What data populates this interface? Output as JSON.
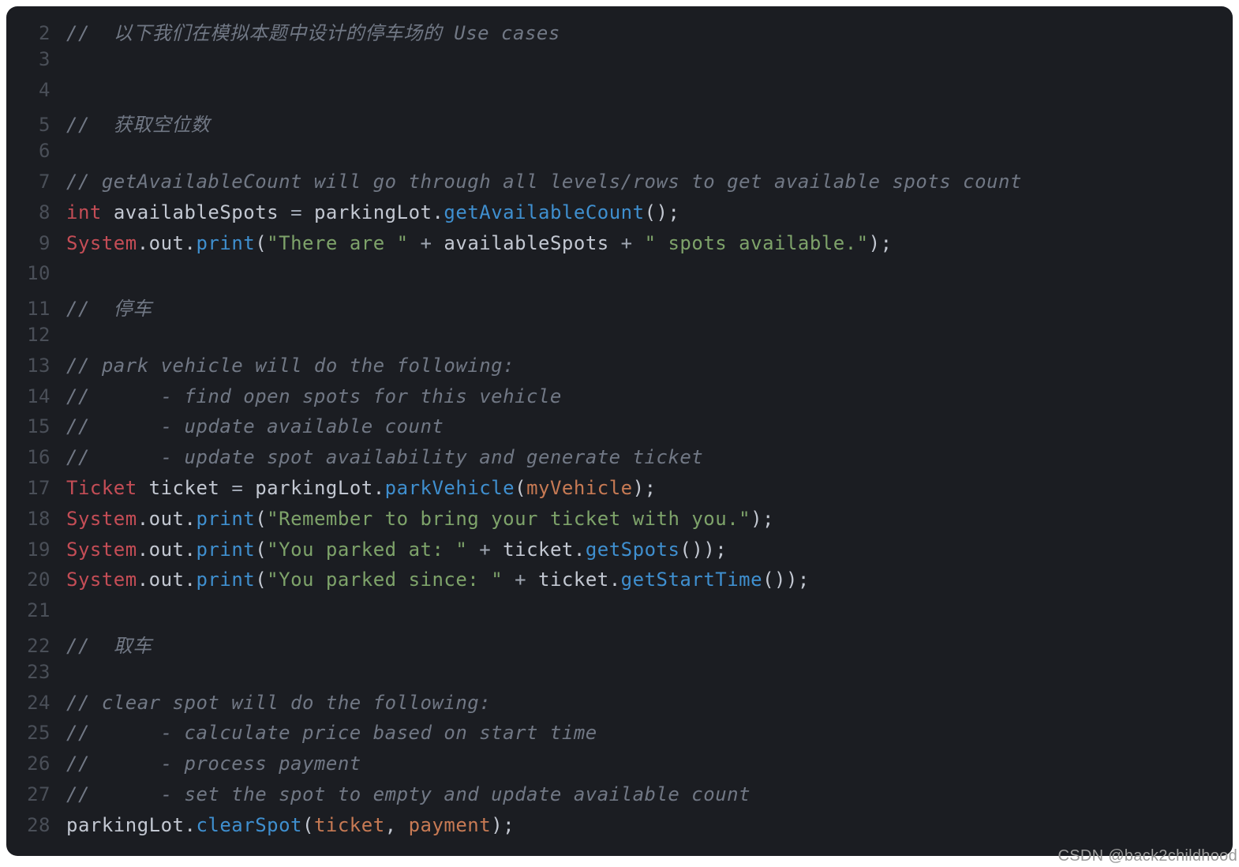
{
  "watermark": "CSDN @back2childhood",
  "lines": [
    {
      "num": "2",
      "tokens": [
        {
          "cls": "tok-comment",
          "text": "//  以下我们在模拟本题中设计的停车场的 Use cases"
        }
      ]
    },
    {
      "num": "3",
      "tokens": []
    },
    {
      "num": "4",
      "tokens": []
    },
    {
      "num": "5",
      "tokens": [
        {
          "cls": "tok-comment",
          "text": "//  获取空位数"
        }
      ]
    },
    {
      "num": "6",
      "tokens": []
    },
    {
      "num": "7",
      "tokens": [
        {
          "cls": "tok-comment",
          "text": "// getAvailableCount will go through all levels/rows to get available spots count"
        }
      ]
    },
    {
      "num": "8",
      "tokens": [
        {
          "cls": "tok-keyword",
          "text": "int"
        },
        {
          "cls": "tok-punct",
          "text": " "
        },
        {
          "cls": "tok-var",
          "text": "availableSpots"
        },
        {
          "cls": "tok-punct",
          "text": " "
        },
        {
          "cls": "tok-op",
          "text": "="
        },
        {
          "cls": "tok-punct",
          "text": " "
        },
        {
          "cls": "tok-obj",
          "text": "parkingLot"
        },
        {
          "cls": "tok-punct",
          "text": "."
        },
        {
          "cls": "tok-method",
          "text": "getAvailableCount"
        },
        {
          "cls": "tok-punct",
          "text": "();"
        }
      ]
    },
    {
      "num": "9",
      "tokens": [
        {
          "cls": "tok-sys",
          "text": "System"
        },
        {
          "cls": "tok-punct",
          "text": "."
        },
        {
          "cls": "tok-objOut",
          "text": "out"
        },
        {
          "cls": "tok-punct",
          "text": "."
        },
        {
          "cls": "tok-method",
          "text": "print"
        },
        {
          "cls": "tok-punct",
          "text": "("
        },
        {
          "cls": "tok-string",
          "text": "\"There are \""
        },
        {
          "cls": "tok-punct",
          "text": " "
        },
        {
          "cls": "tok-op",
          "text": "+"
        },
        {
          "cls": "tok-punct",
          "text": " "
        },
        {
          "cls": "tok-var",
          "text": "availableSpots"
        },
        {
          "cls": "tok-punct",
          "text": " "
        },
        {
          "cls": "tok-op",
          "text": "+"
        },
        {
          "cls": "tok-punct",
          "text": " "
        },
        {
          "cls": "tok-string",
          "text": "\" spots available.\""
        },
        {
          "cls": "tok-punct",
          "text": ");"
        }
      ]
    },
    {
      "num": "10",
      "tokens": []
    },
    {
      "num": "11",
      "tokens": [
        {
          "cls": "tok-comment",
          "text": "//  停车"
        }
      ]
    },
    {
      "num": "12",
      "tokens": []
    },
    {
      "num": "13",
      "tokens": [
        {
          "cls": "tok-comment",
          "text": "// park vehicle will do the following:"
        }
      ]
    },
    {
      "num": "14",
      "tokens": [
        {
          "cls": "tok-comment",
          "text": "//      - find open spots for this vehicle"
        }
      ]
    },
    {
      "num": "15",
      "tokens": [
        {
          "cls": "tok-comment",
          "text": "//      - update available count"
        }
      ]
    },
    {
      "num": "16",
      "tokens": [
        {
          "cls": "tok-comment",
          "text": "//      - update spot availability and generate ticket"
        }
      ]
    },
    {
      "num": "17",
      "tokens": [
        {
          "cls": "tok-type",
          "text": "Ticket"
        },
        {
          "cls": "tok-punct",
          "text": " "
        },
        {
          "cls": "tok-var",
          "text": "ticket"
        },
        {
          "cls": "tok-punct",
          "text": " "
        },
        {
          "cls": "tok-op",
          "text": "="
        },
        {
          "cls": "tok-punct",
          "text": " "
        },
        {
          "cls": "tok-obj",
          "text": "parkingLot"
        },
        {
          "cls": "tok-punct",
          "text": "."
        },
        {
          "cls": "tok-method",
          "text": "parkVehicle"
        },
        {
          "cls": "tok-punct",
          "text": "("
        },
        {
          "cls": "tok-param",
          "text": "myVehicle"
        },
        {
          "cls": "tok-punct",
          "text": ");"
        }
      ]
    },
    {
      "num": "18",
      "tokens": [
        {
          "cls": "tok-sys",
          "text": "System"
        },
        {
          "cls": "tok-punct",
          "text": "."
        },
        {
          "cls": "tok-objOut",
          "text": "out"
        },
        {
          "cls": "tok-punct",
          "text": "."
        },
        {
          "cls": "tok-method",
          "text": "print"
        },
        {
          "cls": "tok-punct",
          "text": "("
        },
        {
          "cls": "tok-string",
          "text": "\"Remember to bring your ticket with you.\""
        },
        {
          "cls": "tok-punct",
          "text": ");"
        }
      ]
    },
    {
      "num": "19",
      "tokens": [
        {
          "cls": "tok-sys",
          "text": "System"
        },
        {
          "cls": "tok-punct",
          "text": "."
        },
        {
          "cls": "tok-objOut",
          "text": "out"
        },
        {
          "cls": "tok-punct",
          "text": "."
        },
        {
          "cls": "tok-method",
          "text": "print"
        },
        {
          "cls": "tok-punct",
          "text": "("
        },
        {
          "cls": "tok-string",
          "text": "\"You parked at: \""
        },
        {
          "cls": "tok-punct",
          "text": " "
        },
        {
          "cls": "tok-op",
          "text": "+"
        },
        {
          "cls": "tok-punct",
          "text": " "
        },
        {
          "cls": "tok-obj",
          "text": "ticket"
        },
        {
          "cls": "tok-punct",
          "text": "."
        },
        {
          "cls": "tok-method",
          "text": "getSpots"
        },
        {
          "cls": "tok-punct",
          "text": "());"
        }
      ]
    },
    {
      "num": "20",
      "tokens": [
        {
          "cls": "tok-sys",
          "text": "System"
        },
        {
          "cls": "tok-punct",
          "text": "."
        },
        {
          "cls": "tok-objOut",
          "text": "out"
        },
        {
          "cls": "tok-punct",
          "text": "."
        },
        {
          "cls": "tok-method",
          "text": "print"
        },
        {
          "cls": "tok-punct",
          "text": "("
        },
        {
          "cls": "tok-string",
          "text": "\"You parked since: \""
        },
        {
          "cls": "tok-punct",
          "text": " "
        },
        {
          "cls": "tok-op",
          "text": "+"
        },
        {
          "cls": "tok-punct",
          "text": " "
        },
        {
          "cls": "tok-obj",
          "text": "ticket"
        },
        {
          "cls": "tok-punct",
          "text": "."
        },
        {
          "cls": "tok-method",
          "text": "getStartTime"
        },
        {
          "cls": "tok-punct",
          "text": "());"
        }
      ]
    },
    {
      "num": "21",
      "tokens": []
    },
    {
      "num": "22",
      "tokens": [
        {
          "cls": "tok-comment",
          "text": "//  取车"
        }
      ]
    },
    {
      "num": "23",
      "tokens": []
    },
    {
      "num": "24",
      "tokens": [
        {
          "cls": "tok-comment",
          "text": "// clear spot will do the following:"
        }
      ]
    },
    {
      "num": "25",
      "tokens": [
        {
          "cls": "tok-comment",
          "text": "//      - calculate price based on start time"
        }
      ]
    },
    {
      "num": "26",
      "tokens": [
        {
          "cls": "tok-comment",
          "text": "//      - process payment"
        }
      ]
    },
    {
      "num": "27",
      "tokens": [
        {
          "cls": "tok-comment",
          "text": "//      - set the spot to empty and update available count"
        }
      ]
    },
    {
      "num": "28",
      "tokens": [
        {
          "cls": "tok-obj",
          "text": "parkingLot"
        },
        {
          "cls": "tok-punct",
          "text": "."
        },
        {
          "cls": "tok-method",
          "text": "clearSpot"
        },
        {
          "cls": "tok-punct",
          "text": "("
        },
        {
          "cls": "tok-param",
          "text": "ticket"
        },
        {
          "cls": "tok-punct",
          "text": ", "
        },
        {
          "cls": "tok-param",
          "text": "payment"
        },
        {
          "cls": "tok-punct",
          "text": ");"
        }
      ]
    }
  ]
}
